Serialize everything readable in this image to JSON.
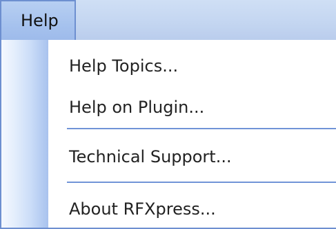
{
  "menubar": {
    "active_menu": "Help"
  },
  "menu": {
    "items": [
      {
        "label": "Help Topics..."
      },
      {
        "label": "Help on Plugin..."
      },
      {
        "label": "Technical Support..."
      },
      {
        "label": "About RFXpress..."
      }
    ]
  },
  "colors": {
    "menubar_bg": "#c4d6f1",
    "active_menu_bg": "#a6c2ee",
    "border": "#6d8fd0",
    "gutter_edge": "#a8c2ee",
    "separator": "#7093d7",
    "menu_bg": "#ffffff",
    "text": "#222222"
  }
}
